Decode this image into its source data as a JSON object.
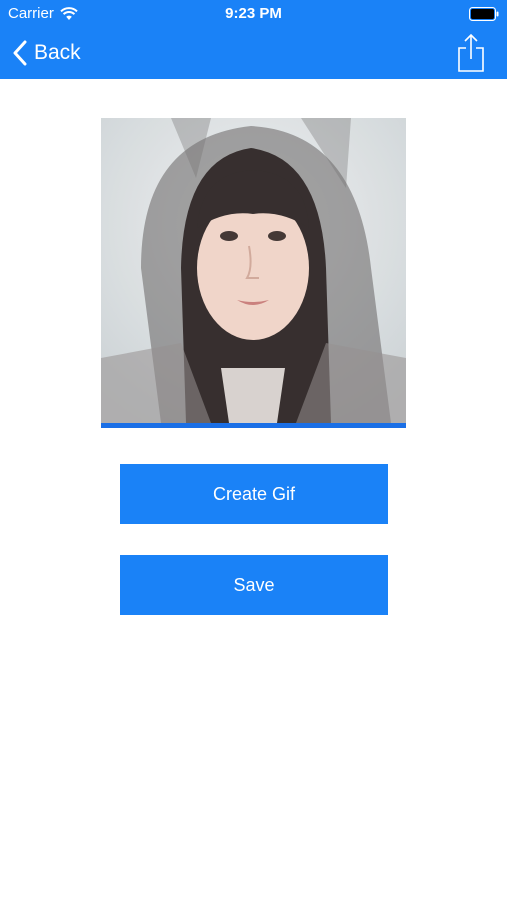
{
  "status_bar": {
    "carrier": "Carrier",
    "time": "9:23 PM"
  },
  "nav": {
    "back_label": "Back",
    "back_icon": "chevron-left-icon",
    "share_icon": "share-icon"
  },
  "photo": {
    "progress_fraction": 1.0
  },
  "buttons": {
    "create_gif": "Create Gif",
    "save": "Save"
  },
  "colors": {
    "accent": "#1a82f7",
    "progress": "#1a6fe6",
    "background": "#ffffff",
    "text_on_accent": "#ffffff"
  }
}
